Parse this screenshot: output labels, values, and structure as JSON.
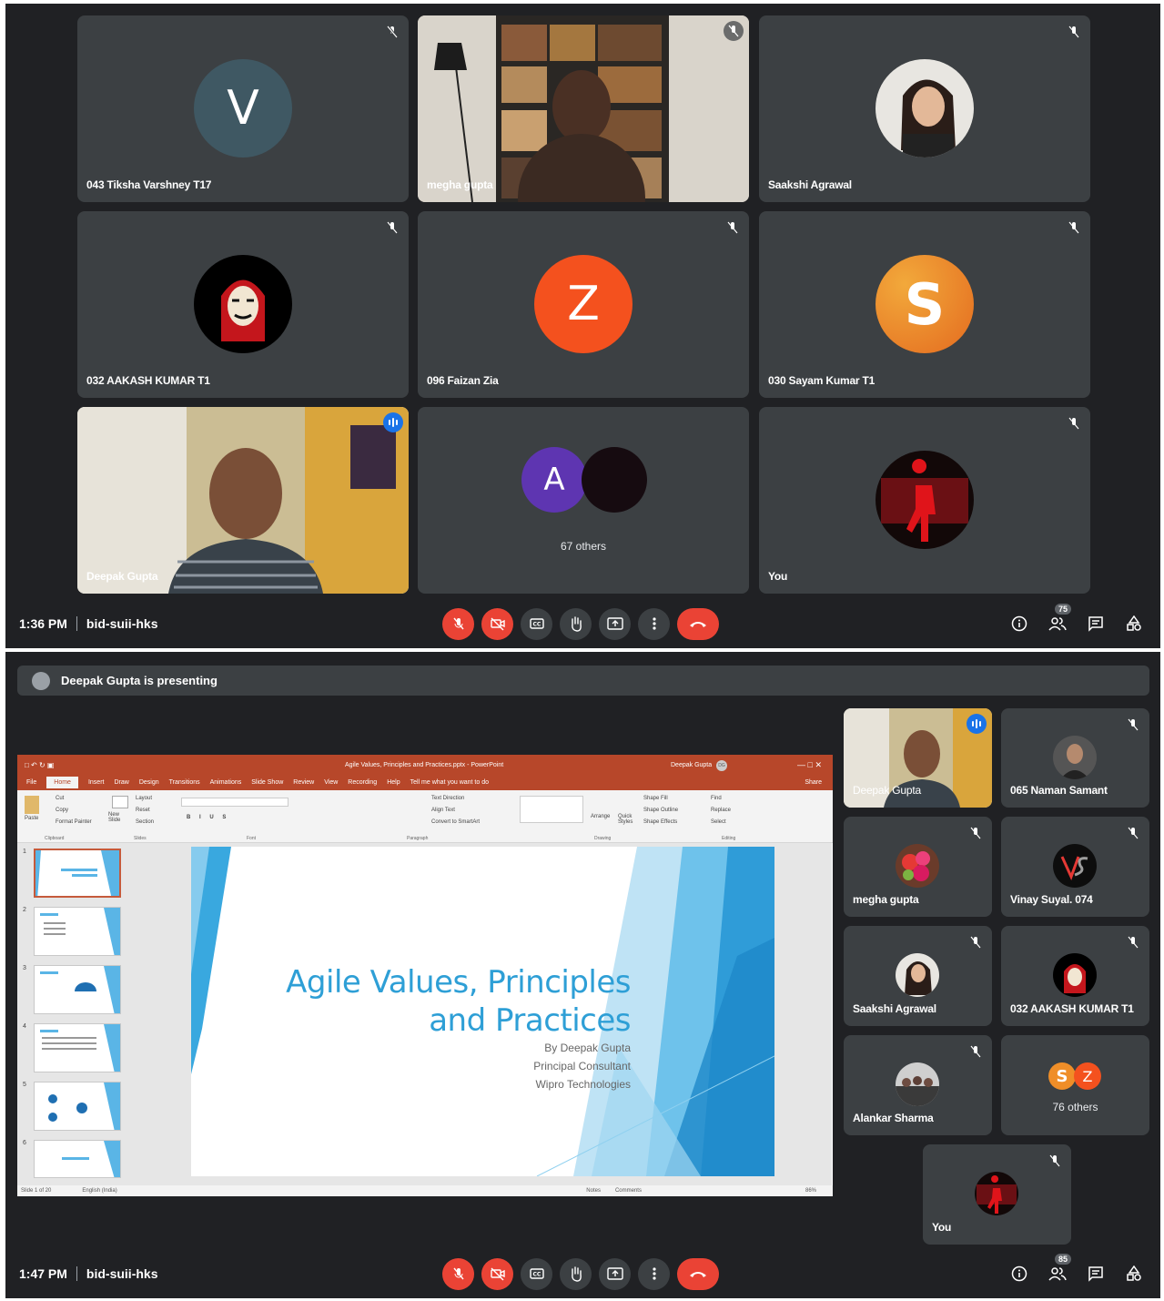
{
  "meeting_top": {
    "tiles": [
      {
        "name": "043 Tiksha Varshney T17",
        "avatar_letter": "V",
        "avatar_color": "#3f5863"
      },
      {
        "name": "megha gupta"
      },
      {
        "name": "Saakshi Agrawal"
      },
      {
        "name": "032 AAKASH KUMAR T1"
      },
      {
        "name": "096 Faizan Zia",
        "avatar_letter": "Z",
        "avatar_color": "#f4511e"
      },
      {
        "name": "030 Sayam Kumar T1",
        "avatar_letter": "S",
        "avatar_color": "#ef8e28"
      },
      {
        "name": "Deepak Gupta"
      },
      {
        "name": "67 others",
        "avatar_letter": "A",
        "avatar_color": "#5e35b1"
      },
      {
        "name": "You"
      }
    ],
    "time": "1:36 PM",
    "meeting_code": "bid-suii-hks",
    "people_count": "75"
  },
  "meeting_bottom": {
    "presenting_text": "Deepak Gupta is presenting",
    "tiles": [
      {
        "name": "Deepak Gupta"
      },
      {
        "name": "065 Naman Samant"
      },
      {
        "name": "megha gupta"
      },
      {
        "name": "Vinay Suyal. 074"
      },
      {
        "name": "Saakshi Agrawal"
      },
      {
        "name": "032 AAKASH KUMAR T1"
      },
      {
        "name": "Alankar Sharma"
      },
      {
        "name": "76 others",
        "avatar_letters": [
          "S",
          "Z"
        ]
      },
      {
        "name": "You"
      }
    ],
    "time": "1:47 PM",
    "meeting_code": "bid-suii-hks",
    "people_count": "85"
  },
  "ppt": {
    "window_title": "Agile Values, Principles and Practices.pptx  -  PowerPoint",
    "user": "Deepak Gupta",
    "user_initials": "DG",
    "share_label": "Share",
    "tabs": [
      "File",
      "Home",
      "Insert",
      "Draw",
      "Design",
      "Transitions",
      "Animations",
      "Slide Show",
      "Review",
      "View",
      "Recording",
      "Help",
      "Tell me what you want to do"
    ],
    "ribbon_groups": [
      "Clipboard",
      "Slides",
      "Font",
      "Paragraph",
      "Drawing",
      "Editing"
    ],
    "ribbon_items": {
      "paste": "Paste",
      "cut": "Cut",
      "copy": "Copy",
      "format_painter": "Format Painter",
      "new_slide": "New Slide",
      "layout": "Layout",
      "reset": "Reset",
      "section": "Section",
      "text_direction": "Text Direction",
      "align_text": "Align Text",
      "convert": "Convert to SmartArt",
      "arrange": "Arrange",
      "quick_styles": "Quick Styles",
      "shape_fill": "Shape Fill",
      "shape_outline": "Shape Outline",
      "shape_effects": "Shape Effects",
      "find": "Find",
      "replace": "Replace",
      "select": "Select"
    },
    "slide_title_line1": "Agile Values, Principles",
    "slide_title_line2": "and Practices",
    "slide_sub1": "By Deepak Gupta",
    "slide_sub2": "Principal Consultant",
    "slide_sub3": "Wipro Technologies",
    "thumb_numbers": [
      "1",
      "2",
      "3",
      "4",
      "5",
      "6"
    ],
    "status_left": "Slide 1 of 20",
    "status_lang": "English (India)",
    "status_notes": "Notes",
    "status_comments": "Comments",
    "zoom": "86%"
  }
}
